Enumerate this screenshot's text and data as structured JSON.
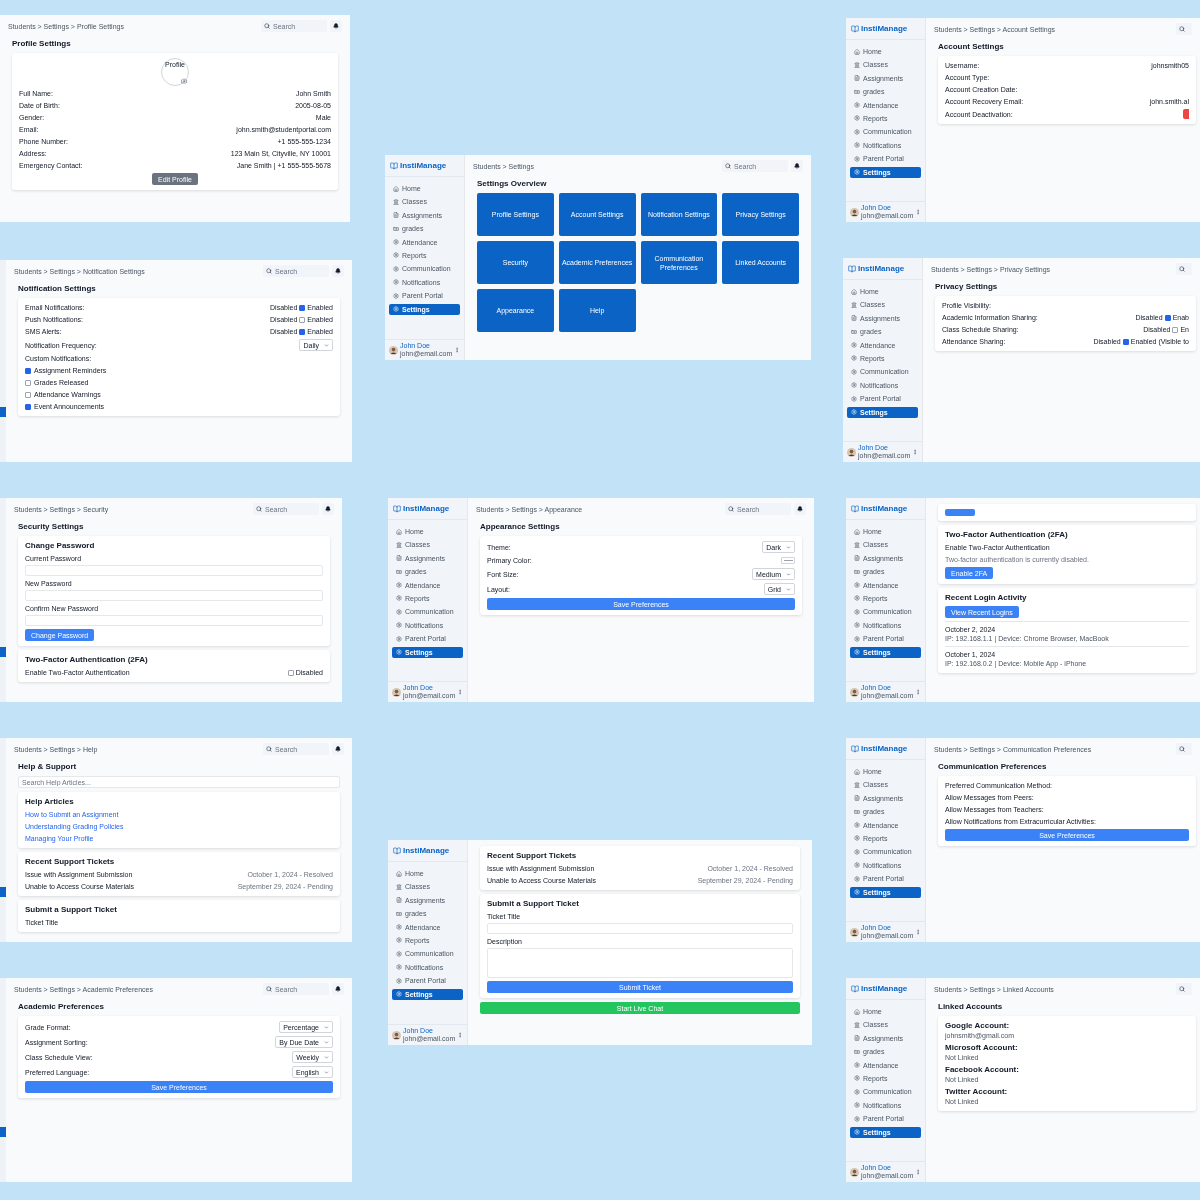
{
  "panels": [
    {
      "kind": "plain",
      "breadcrumb": "Students > Settings > Profile Settings",
      "search": {
        "placeholder": "Search"
      },
      "title": "Profile Settings",
      "content": [
        {
          "kind": "card",
          "blocks": [
            {
              "kind": "avatar",
              "alt": "Profile"
            },
            {
              "kind": "pair",
              "label": "Full Name:",
              "value": "John Smith"
            },
            {
              "kind": "pair",
              "label": "Date of Birth:",
              "value": "2005-08-05"
            },
            {
              "kind": "pair",
              "label": "Gender:",
              "value": "Male"
            },
            {
              "kind": "pair",
              "label": "Email:",
              "value": "john.smith@studentportal.com"
            },
            {
              "kind": "pair",
              "label": "Phone Number:",
              "value": "+1 555-555-1234"
            },
            {
              "kind": "pair",
              "label": "Address:",
              "value": "123 Main St, Cityville, NY 10001"
            },
            {
              "kind": "pair",
              "label": "Emergency Contact:",
              "value": "Jane Smith | +1 555-555-5678"
            },
            {
              "kind": "edit-button",
              "label": "Edit Profile"
            }
          ]
        }
      ]
    },
    {
      "kind": "strip",
      "breadcrumb": "Students > Settings > Notification Settings",
      "search": {
        "placeholder": "Search"
      },
      "title": "Notification Settings",
      "content": [
        {
          "kind": "card",
          "blocks": [
            {
              "kind": "toggle",
              "label": "Email Notifications:",
              "off_label": "Disabled",
              "checked": true,
              "on_label": "Enabled"
            },
            {
              "kind": "toggle",
              "label": "Push Notifications:",
              "off_label": "Disabled",
              "checked": false,
              "on_label": "Enabled"
            },
            {
              "kind": "toggle",
              "label": "SMS Alerts:",
              "off_label": "Disabled",
              "checked": true,
              "on_label": "Enabled"
            },
            {
              "kind": "select",
              "label": "Notification Frequency:",
              "value": "Daily"
            },
            {
              "kind": "label",
              "text": "Custom Notifications:"
            },
            {
              "kind": "check",
              "label": "Assignment Reminders",
              "checked": true
            },
            {
              "kind": "check",
              "label": "Grades Released",
              "checked": false
            },
            {
              "kind": "check",
              "label": "Attendance Warnings",
              "checked": false
            },
            {
              "kind": "check",
              "label": "Event Announcements",
              "checked": true
            }
          ]
        }
      ]
    },
    {
      "kind": "strip",
      "breadcrumb": "Students > Settings > Security",
      "search": {
        "placeholder": "Search"
      },
      "title": "Security Settings",
      "content": [
        {
          "kind": "card",
          "title": "Change Password",
          "blocks": [
            {
              "kind": "input",
              "label": "Current Password"
            },
            {
              "kind": "input",
              "label": "New Password"
            },
            {
              "kind": "input",
              "label": "Confirm New Password"
            },
            {
              "kind": "button",
              "label": "Change Password"
            }
          ]
        },
        {
          "kind": "card",
          "title": "Two-Factor Authentication (2FA)",
          "blocks": [
            {
              "kind": "switch",
              "label": "Enable Two-Factor Authentication",
              "checked": false,
              "state_label": "Disabled"
            }
          ]
        }
      ]
    },
    {
      "kind": "strip",
      "breadcrumb": "Students > Settings > Help",
      "search": {
        "placeholder": "Search"
      },
      "title": "Help & Support",
      "content": [
        {
          "kind": "search",
          "placeholder": "Search Help Articles..."
        },
        {
          "kind": "card",
          "title": "Help Articles",
          "blocks": [
            {
              "kind": "link",
              "text": "How to Submit an Assignment"
            },
            {
              "kind": "link",
              "text": "Understanding Grading Policies"
            },
            {
              "kind": "link",
              "text": "Managing Your Profile"
            }
          ]
        },
        {
          "kind": "card",
          "title": "Recent Support Tickets",
          "blocks": [
            {
              "kind": "ticket",
              "text": "Issue with Assignment Submission",
              "meta": "October 1, 2024 - Resolved"
            },
            {
              "kind": "ticket",
              "text": "Unable to Access Course Materials",
              "meta": "September 29, 2024 - Pending"
            }
          ]
        },
        {
          "kind": "card",
          "title": "Submit a Support Ticket",
          "blocks": [
            {
              "kind": "label",
              "text": "Ticket Title"
            }
          ]
        }
      ]
    },
    {
      "kind": "strip",
      "breadcrumb": "Students > Settings > Academic Preferences",
      "search": {
        "placeholder": "Search"
      },
      "title": "Academic Preferences",
      "content": [
        {
          "kind": "card",
          "blocks": [
            {
              "kind": "select",
              "label": "Grade Format:",
              "value": "Percentage"
            },
            {
              "kind": "select",
              "label": "Assignment Sorting:",
              "value": "By Due Date"
            },
            {
              "kind": "select",
              "label": "Class Schedule View:",
              "value": "Weekly"
            },
            {
              "kind": "select",
              "label": "Preferred Language:",
              "value": "English"
            },
            {
              "kind": "wide-button",
              "label": "Save Preferences"
            }
          ]
        }
      ]
    },
    {
      "kind": "full",
      "sidebar": {
        "logo": "InstiManage",
        "items": [
          {
            "label": "Home",
            "selected": false
          },
          {
            "label": "Classes",
            "selected": false
          },
          {
            "label": "Assignments",
            "selected": false
          },
          {
            "label": "grades",
            "selected": false
          },
          {
            "label": "Attendance",
            "selected": false
          },
          {
            "label": "Reports",
            "selected": false
          },
          {
            "label": "Communication",
            "selected": false
          },
          {
            "label": "Notifications",
            "selected": false
          },
          {
            "label": "Parent Portal",
            "selected": false
          },
          {
            "label": "Settings",
            "selected": true
          }
        ],
        "user": {
          "name": "John Doe",
          "email": "john@email.com"
        }
      },
      "breadcrumb": "Students > Settings",
      "search": {
        "placeholder": "Search"
      },
      "title": "Settings Overview",
      "content": [
        {
          "kind": "tiles",
          "items": [
            "Profile Settings",
            "Account Settings",
            "Notification Settings",
            "Privacy Settings",
            "Security",
            "Academic Preferences",
            "Communication Preferences",
            "Linked Accounts",
            "Appearance",
            "Help"
          ]
        }
      ]
    },
    {
      "kind": "full",
      "sidebar": {
        "logo": "InstiManage",
        "items": [
          {
            "label": "Home",
            "selected": false
          },
          {
            "label": "Classes",
            "selected": false
          },
          {
            "label": "Assignments",
            "selected": false
          },
          {
            "label": "grades",
            "selected": false
          },
          {
            "label": "Attendance",
            "selected": false
          },
          {
            "label": "Reports",
            "selected": false
          },
          {
            "label": "Communication",
            "selected": false
          },
          {
            "label": "Notifications",
            "selected": false
          },
          {
            "label": "Parent Portal",
            "selected": false
          },
          {
            "label": "Settings",
            "selected": true
          }
        ],
        "user": {
          "name": "John Doe",
          "email": "john@email.com"
        }
      },
      "breadcrumb": "Students > Settings > Appearance",
      "search": {
        "placeholder": "Search"
      },
      "title": "Appearance Settings",
      "content": [
        {
          "kind": "card",
          "blocks": [
            {
              "kind": "select",
              "label": "Theme:",
              "value": "Dark"
            },
            {
              "kind": "color",
              "label": "Primary Color:"
            },
            {
              "kind": "select",
              "label": "Font Size:",
              "value": "Medium"
            },
            {
              "kind": "select",
              "label": "Layout:",
              "value": "Grid"
            },
            {
              "kind": "wide-button",
              "label": "Save Preferences"
            }
          ]
        }
      ]
    },
    {
      "kind": "full",
      "sidebar": {
        "logo": "InstiManage",
        "items": [
          {
            "label": "Home",
            "selected": false
          },
          {
            "label": "Classes",
            "selected": false
          },
          {
            "label": "Assignments",
            "selected": false
          },
          {
            "label": "grades",
            "selected": false
          },
          {
            "label": "Attendance",
            "selected": false
          },
          {
            "label": "Reports",
            "selected": false
          },
          {
            "label": "Communication",
            "selected": false
          },
          {
            "label": "Notifications",
            "selected": false
          },
          {
            "label": "Parent Portal",
            "selected": false
          },
          {
            "label": "Settings",
            "selected": true
          }
        ],
        "user": {
          "name": "John Doe",
          "email": "john@email.com"
        }
      },
      "content": [
        {
          "kind": "card",
          "title": "Recent Support Tickets",
          "blocks": [
            {
              "kind": "ticket",
              "text": "Issue with Assignment Submission",
              "meta": "October 1, 2024 - Resolved"
            },
            {
              "kind": "ticket",
              "text": "Unable to Access Course Materials",
              "meta": "September 29, 2024 - Pending"
            }
          ]
        },
        {
          "kind": "card",
          "title": "Submit a Support Ticket",
          "blocks": [
            {
              "kind": "input",
              "label": "Ticket Title"
            },
            {
              "kind": "textarea",
              "label": "Description"
            },
            {
              "kind": "wide-button",
              "label": "Submit Ticket"
            }
          ]
        },
        {
          "kind": "chat-button",
          "label": "Start Live Chat"
        }
      ]
    },
    {
      "kind": "right-cut",
      "sidebar": {
        "logo": "InstiManage",
        "items": [
          {
            "label": "Home",
            "selected": false
          },
          {
            "label": "Classes",
            "selected": false
          },
          {
            "label": "Assignments",
            "selected": false
          },
          {
            "label": "grades",
            "selected": false
          },
          {
            "label": "Attendance",
            "selected": false
          },
          {
            "label": "Reports",
            "selected": false
          },
          {
            "label": "Communication",
            "selected": false
          },
          {
            "label": "Notifications",
            "selected": false
          },
          {
            "label": "Parent Portal",
            "selected": false
          },
          {
            "label": "Settings",
            "selected": true
          }
        ],
        "user": {
          "name": "John Doe",
          "email": "john@email.com"
        }
      },
      "breadcrumb": "Students > Settings > Account Settings",
      "title": "Account Settings",
      "content": [
        {
          "kind": "card",
          "blocks": [
            {
              "kind": "pair",
              "label": "Username:",
              "value": "johnsmith05"
            },
            {
              "kind": "pair",
              "label": "Account Type:"
            },
            {
              "kind": "pair",
              "label": "Account Creation Date:"
            },
            {
              "kind": "pair",
              "label": "Account Recovery Email:",
              "value": "john.smith.al"
            },
            {
              "kind": "action",
              "label": "Account Deactivation:"
            }
          ]
        }
      ]
    },
    {
      "kind": "right-cut",
      "sidebar": {
        "logo": "InstiManage",
        "items": [
          {
            "label": "Home",
            "selected": false
          },
          {
            "label": "Classes",
            "selected": false
          },
          {
            "label": "Assignments",
            "selected": false
          },
          {
            "label": "grades",
            "selected": false
          },
          {
            "label": "Attendance",
            "selected": false
          },
          {
            "label": "Reports",
            "selected": false
          },
          {
            "label": "Communication",
            "selected": false
          },
          {
            "label": "Notifications",
            "selected": false
          },
          {
            "label": "Parent Portal",
            "selected": false
          },
          {
            "label": "Settings",
            "selected": true
          }
        ],
        "user": {
          "name": "John Doe",
          "email": "john@email.com"
        }
      },
      "breadcrumb": "Students > Settings > Privacy Settings",
      "title": "Privacy Settings",
      "content": [
        {
          "kind": "card",
          "blocks": [
            {
              "kind": "pair",
              "label": "Profile Visibility:"
            },
            {
              "kind": "toggle",
              "label": "Academic Information Sharing:",
              "off_label": "Disabled",
              "checked": true,
              "on_label": "Enab"
            },
            {
              "kind": "toggle",
              "label": "Class Schedule Sharing:",
              "off_label": "Disabled",
              "checked": false,
              "on_label": "En"
            },
            {
              "kind": "toggle",
              "label": "Attendance Sharing:",
              "off_label": "Disabled",
              "checked": true,
              "on_label": "Enabled (Visible to"
            }
          ]
        }
      ]
    },
    {
      "kind": "right-cut",
      "sidebar": {
        "logo": "InstiManage",
        "items": [
          {
            "label": "Home",
            "selected": false
          },
          {
            "label": "Classes",
            "selected": false
          },
          {
            "label": "Assignments",
            "selected": false
          },
          {
            "label": "grades",
            "selected": false
          },
          {
            "label": "Attendance",
            "selected": false
          },
          {
            "label": "Reports",
            "selected": false
          },
          {
            "label": "Communication",
            "selected": false
          },
          {
            "label": "Notifications",
            "selected": false
          },
          {
            "label": "Parent Portal",
            "selected": false
          },
          {
            "label": "Settings",
            "selected": true
          }
        ],
        "user": {
          "name": "John Doe",
          "email": "john@email.com"
        }
      },
      "content": [
        {
          "kind": "card",
          "blocks": [
            {
              "kind": "button"
            }
          ]
        },
        {
          "kind": "card",
          "title": "Two-Factor Authentication (2FA)",
          "blocks": [
            {
              "kind": "label",
              "text": "Enable Two-Factor Authentication"
            },
            {
              "kind": "note",
              "text": "Two-factor authentication is currently disabled."
            },
            {
              "kind": "button",
              "label": "Enable 2FA"
            }
          ]
        },
        {
          "kind": "card",
          "title": "Recent Login Activity",
          "blocks": [
            {
              "kind": "button",
              "label": "View Recent Logins"
            },
            {
              "kind": "login",
              "date": "October 2, 2024",
              "detail": "IP: 192.168.1.1 | Device: Chrome Browser, MacBook"
            },
            {
              "kind": "login",
              "date": "October 1, 2024",
              "detail": "IP: 192.168.0.2 | Device: Mobile App - iPhone"
            }
          ]
        }
      ]
    },
    {
      "kind": "right-cut",
      "sidebar": {
        "logo": "InstiManage",
        "items": [
          {
            "label": "Home",
            "selected": false
          },
          {
            "label": "Classes",
            "selected": false
          },
          {
            "label": "Assignments",
            "selected": false
          },
          {
            "label": "grades",
            "selected": false
          },
          {
            "label": "Attendance",
            "selected": false
          },
          {
            "label": "Reports",
            "selected": false
          },
          {
            "label": "Communication",
            "selected": false
          },
          {
            "label": "Notifications",
            "selected": false
          },
          {
            "label": "Parent Portal",
            "selected": false
          },
          {
            "label": "Settings",
            "selected": true
          }
        ],
        "user": {
          "name": "John Doe",
          "email": "john@email.com"
        }
      },
      "breadcrumb": "Students > Settings > Communication Preferences",
      "title": "Communication Preferences",
      "content": [
        {
          "kind": "card",
          "blocks": [
            {
              "kind": "pair",
              "label": "Preferred Communication Method:"
            },
            {
              "kind": "pair",
              "label": "Allow Messages from Peers:"
            },
            {
              "kind": "pair",
              "label": "Allow Messages from Teachers:"
            },
            {
              "kind": "pair",
              "label": "Allow Notifications from Extracurricular Activities:"
            },
            {
              "kind": "wide-button",
              "label": "Save Preferences"
            }
          ]
        }
      ]
    },
    {
      "kind": "right-cut",
      "sidebar": {
        "logo": "InstiManage",
        "items": [
          {
            "label": "Home",
            "selected": false
          },
          {
            "label": "Classes",
            "selected": false
          },
          {
            "label": "Assignments",
            "selected": false
          },
          {
            "label": "grades",
            "selected": false
          },
          {
            "label": "Attendance",
            "selected": false
          },
          {
            "label": "Reports",
            "selected": false
          },
          {
            "label": "Communication",
            "selected": false
          },
          {
            "label": "Notifications",
            "selected": false
          },
          {
            "label": "Parent Portal",
            "selected": false
          },
          {
            "label": "Settings",
            "selected": true
          }
        ],
        "user": {
          "name": "John Doe",
          "email": "john@email.com"
        }
      },
      "breadcrumb": "Students > Settings > Linked Accounts",
      "title": "Linked Accounts",
      "content": [
        {
          "kind": "card",
          "blocks": [
            {
              "kind": "account",
              "name": "Google Account:",
              "status": "johnsmith@gmail.com"
            },
            {
              "kind": "account",
              "name": "Microsoft Account:",
              "status": "Not Linked"
            },
            {
              "kind": "account",
              "name": "Facebook Account:",
              "status": "Not Linked"
            },
            {
              "kind": "account",
              "name": "Twitter Account:",
              "status": "Not Linked"
            }
          ]
        }
      ]
    }
  ]
}
